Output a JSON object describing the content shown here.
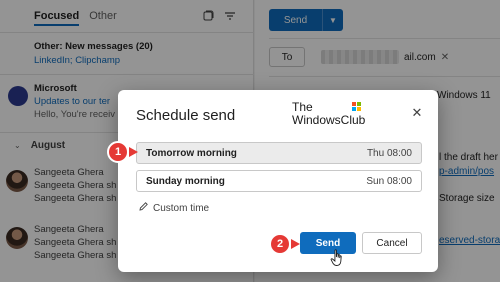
{
  "message_list": {
    "tabs": {
      "focused": "Focused",
      "other": "Other"
    },
    "other_notice": {
      "title": "Other: New messages (20)",
      "senders": "LinkedIn; Clipchamp"
    },
    "microsoft_item": {
      "from": "Microsoft",
      "subject": "Updates to our ter",
      "preview": "Hello, You're receiv"
    },
    "group_label": "August",
    "messages": [
      {
        "from": "Sangeeta Ghera",
        "line2": "Sangeeta Ghera sh",
        "line3": "Sangeeta Ghera sh"
      },
      {
        "from": "Sangeeta Ghera",
        "line2": "Sangeeta Ghera sh",
        "line3": "Sangeeta Ghera sh"
      }
    ]
  },
  "compose": {
    "send_label": "Send",
    "to_label": "To",
    "recipient_suffix": "ail.com",
    "fragments": {
      "windows": "Windows 11",
      "draft": "l the draft her",
      "link1": "p-admin/pos",
      "storage": "Storage size",
      "link2": "eserved-stora"
    }
  },
  "dialog": {
    "title": "Schedule send",
    "brand_line1": "The",
    "brand_line2": "WindowsClub",
    "options": [
      {
        "label": "Tomorrow morning",
        "time": "Thu 08:00",
        "selected": true
      },
      {
        "label": "Sunday morning",
        "time": "Sun 08:00",
        "selected": false
      }
    ],
    "custom_time": "Custom time",
    "send_button": "Send",
    "cancel_button": "Cancel"
  },
  "annotations": {
    "step1": "1",
    "step2": "2",
    "color": "#e53935"
  },
  "colors": {
    "accent": "#0f6cbd",
    "brand_logo": [
      "#f25022",
      "#7fba00",
      "#00a4ef",
      "#ffb900"
    ]
  }
}
